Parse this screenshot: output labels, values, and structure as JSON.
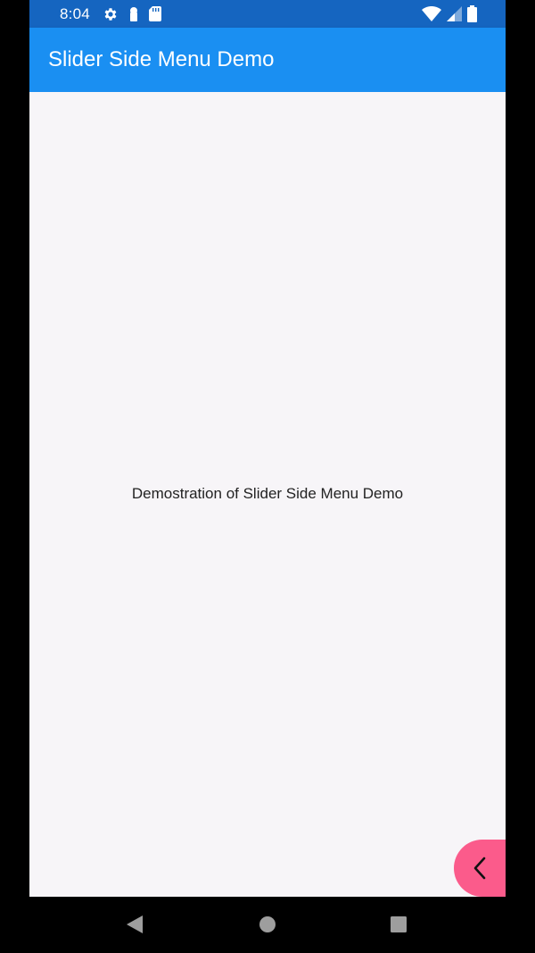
{
  "status_bar": {
    "time": "8:04",
    "background": "#1565c0",
    "left_icons": [
      "gear-icon",
      "keyhole-icon",
      "sd-card-icon"
    ],
    "right_icons": [
      "wifi-icon",
      "cell-signal-icon",
      "battery-icon"
    ]
  },
  "app_bar": {
    "title": "Slider Side Menu Demo",
    "background": "#1a8ff2"
  },
  "main": {
    "text": "Demostration of Slider Side Menu Demo",
    "background": "#f7f5f8"
  },
  "menu_toggle": {
    "icon": "chevron-left-icon",
    "color": "#fb5b8b"
  },
  "nav_bar": {
    "buttons": [
      "back-icon",
      "home-icon",
      "recents-icon"
    ]
  }
}
